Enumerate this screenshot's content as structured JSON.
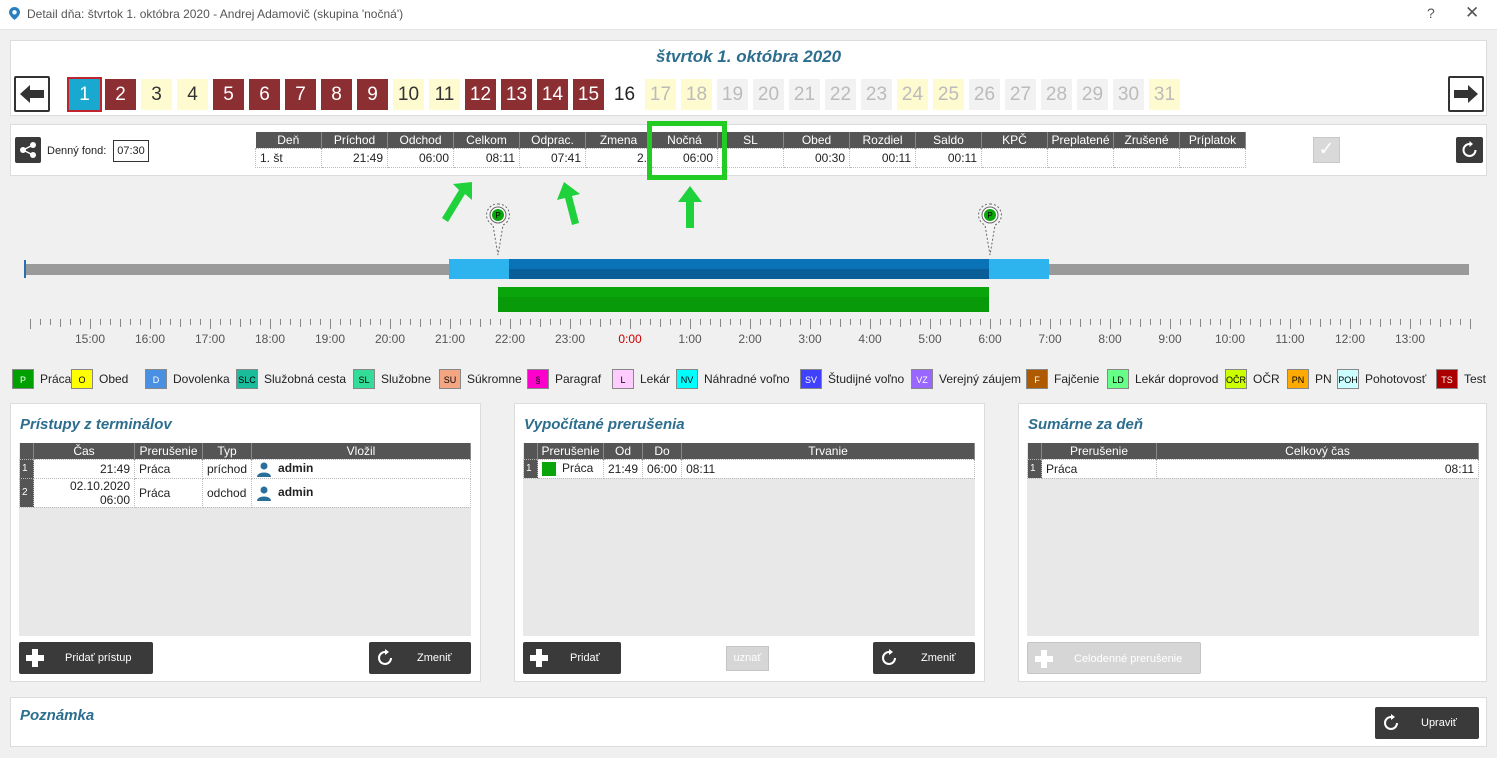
{
  "window": {
    "title": "Detail dňa: štvrtok 1. októbra 2020 -  Andrej Adamovič  (skupina 'nočná')",
    "help": "?",
    "close": "✕"
  },
  "date_title": "štvrtok 1. októbra 2020",
  "days": [
    "1",
    "2",
    "3",
    "4",
    "5",
    "6",
    "7",
    "8",
    "9",
    "10",
    "11",
    "12",
    "13",
    "14",
    "15",
    "16",
    "17",
    "18",
    "19",
    "20",
    "21",
    "22",
    "23",
    "24",
    "25",
    "26",
    "27",
    "28",
    "29",
    "30",
    "31"
  ],
  "fund": {
    "label": "Denný fond:",
    "value": "07:30"
  },
  "summary": {
    "headers": [
      "Deň",
      "Príchod",
      "Odchod",
      "Celkom",
      "Odprac.",
      "Zmena",
      "Nočná",
      "SL",
      "Obed",
      "Rozdiel",
      "Saldo",
      "KPČ",
      "Preplatené",
      "Zrušené",
      "Príplatok"
    ],
    "row": [
      "1. št",
      "21:49",
      "06:00",
      "08:11",
      "07:41",
      "2.",
      "06:00",
      "",
      "00:30",
      "00:11",
      "00:11",
      "",
      "",
      "",
      ""
    ]
  },
  "check_icon": "✓",
  "timeline": {
    "hours": [
      "15:00",
      "16:00",
      "17:00",
      "18:00",
      "19:00",
      "20:00",
      "21:00",
      "22:00",
      "23:00",
      "0:00",
      "1:00",
      "2:00",
      "3:00",
      "4:00",
      "5:00",
      "6:00",
      "7:00",
      "8:00",
      "9:00",
      "10:00",
      "11:00",
      "12:00",
      "13:00"
    ],
    "highlight_hour": "0:00",
    "highlight_color": "#cc0000",
    "pin_label": "P"
  },
  "legend": [
    {
      "code": "P",
      "label": "Práca",
      "color": "#00a000",
      "fg": "#fff"
    },
    {
      "code": "O",
      "label": "Obed",
      "color": "#ffff00",
      "fg": "#000"
    },
    {
      "code": "D",
      "label": "Dovolenka",
      "color": "#4a90e2",
      "fg": "#fff"
    },
    {
      "code": "SLC",
      "label": "Služobná cesta",
      "color": "#1abc9c",
      "fg": "#000"
    },
    {
      "code": "SL",
      "label": "Služobne",
      "color": "#33dd99",
      "fg": "#000"
    },
    {
      "code": "SU",
      "label": "Súkromne",
      "color": "#f4a582",
      "fg": "#000"
    },
    {
      "code": "§",
      "label": "Paragraf",
      "color": "#ff00cc",
      "fg": "#000"
    },
    {
      "code": "L",
      "label": "Lekár",
      "color": "#ffccff",
      "fg": "#000"
    },
    {
      "code": "NV",
      "label": "Náhradné voľno",
      "color": "#00ffff",
      "fg": "#000"
    },
    {
      "code": "SV",
      "label": "Študijné voľno",
      "color": "#4040ff",
      "fg": "#fff"
    },
    {
      "code": "VZ",
      "label": "Verejný záujem",
      "color": "#9966ff",
      "fg": "#fff"
    },
    {
      "code": "F",
      "label": "Fajčenie",
      "color": "#b05a00",
      "fg": "#fff"
    },
    {
      "code": "LD",
      "label": "Lekár doprovod",
      "color": "#66ff88",
      "fg": "#000"
    },
    {
      "code": "OČR",
      "label": "OČR",
      "color": "#ccff00",
      "fg": "#000"
    },
    {
      "code": "PN",
      "label": "PN",
      "color": "#ffaa00",
      "fg": "#000"
    },
    {
      "code": "POH",
      "label": "Pohotovosť",
      "color": "#ccffff",
      "fg": "#000"
    },
    {
      "code": "TS",
      "label": "Test",
      "color": "#aa0000",
      "fg": "#fff"
    }
  ],
  "access": {
    "title": "Prístupy z terminálov",
    "headers": [
      "Čas",
      "Prerušenie",
      "Typ",
      "Vložil"
    ],
    "rows": [
      {
        "n": "1",
        "time": "21:49",
        "type": "Práca",
        "dir": "príchod",
        "by": "admin"
      },
      {
        "n": "2",
        "time": "02.10.2020 06:00",
        "type": "Práca",
        "dir": "odchod",
        "by": "admin"
      }
    ],
    "add": "Pridať prístup",
    "change": "Zmeniť"
  },
  "computed": {
    "title": "Vypočítané prerušenia",
    "headers": [
      "Prerušenie",
      "Od",
      "Do",
      "Trvanie"
    ],
    "rows": [
      {
        "n": "1",
        "type": "Práca",
        "from": "21:49",
        "to": "06:00",
        "dur": "08:11"
      }
    ],
    "add": "Pridať",
    "recognize": "uznať",
    "change": "Zmeniť"
  },
  "totals": {
    "title": "Sumárne za deň",
    "headers": [
      "Prerušenie",
      "Celkový čas"
    ],
    "rows": [
      {
        "n": "1",
        "type": "Práca",
        "total": "08:11"
      }
    ],
    "fullday": "Celodenné prerušenie"
  },
  "note": {
    "title": "Poznámka",
    "edit": "Upraviť"
  }
}
